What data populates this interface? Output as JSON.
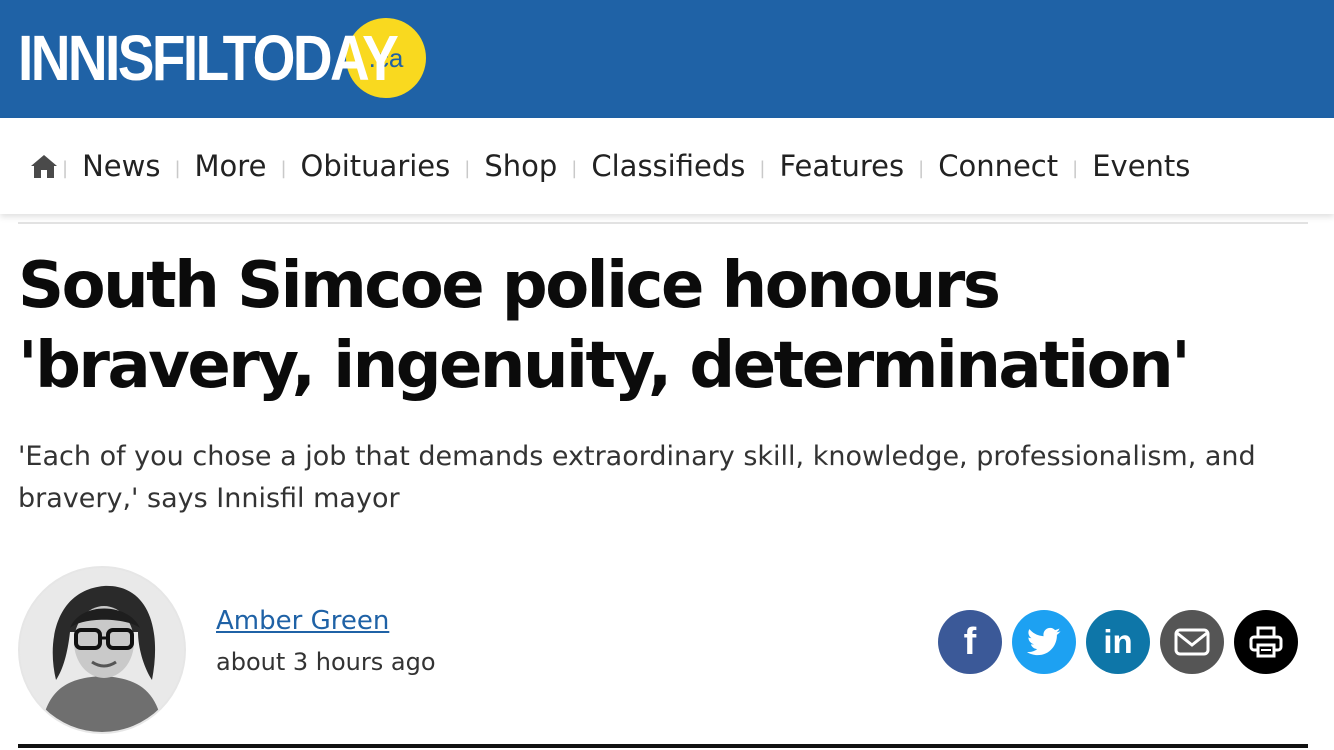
{
  "site": {
    "logo_text": "INNISFILTODAY",
    "logo_suffix": ".ca"
  },
  "nav": {
    "home_icon": "home-icon",
    "items": [
      {
        "label": "News"
      },
      {
        "label": "More"
      },
      {
        "label": "Obituaries"
      },
      {
        "label": "Shop"
      },
      {
        "label": "Classifieds"
      },
      {
        "label": "Features"
      },
      {
        "label": "Connect"
      },
      {
        "label": "Events"
      }
    ]
  },
  "article": {
    "headline": "South Simcoe police honours 'bravery, ingenuity, determination'",
    "deck": "'Each of you chose a job that demands extraordinary skill, knowledge, professionalism, and bravery,' says Innisfil mayor",
    "author": "Amber Green",
    "published": "about 3 hours ago"
  },
  "share": [
    {
      "name": "facebook",
      "icon": "facebook-icon",
      "color": "#3b5998"
    },
    {
      "name": "twitter",
      "icon": "twitter-icon",
      "color": "#1da1f2"
    },
    {
      "name": "linkedin",
      "icon": "linkedin-icon",
      "color": "#0e76a8"
    },
    {
      "name": "email",
      "icon": "email-icon",
      "color": "#555555"
    },
    {
      "name": "print",
      "icon": "print-icon",
      "color": "#000000"
    }
  ],
  "colors": {
    "brand_blue": "#1f62a6",
    "logo_yellow": "#f9d91f"
  }
}
